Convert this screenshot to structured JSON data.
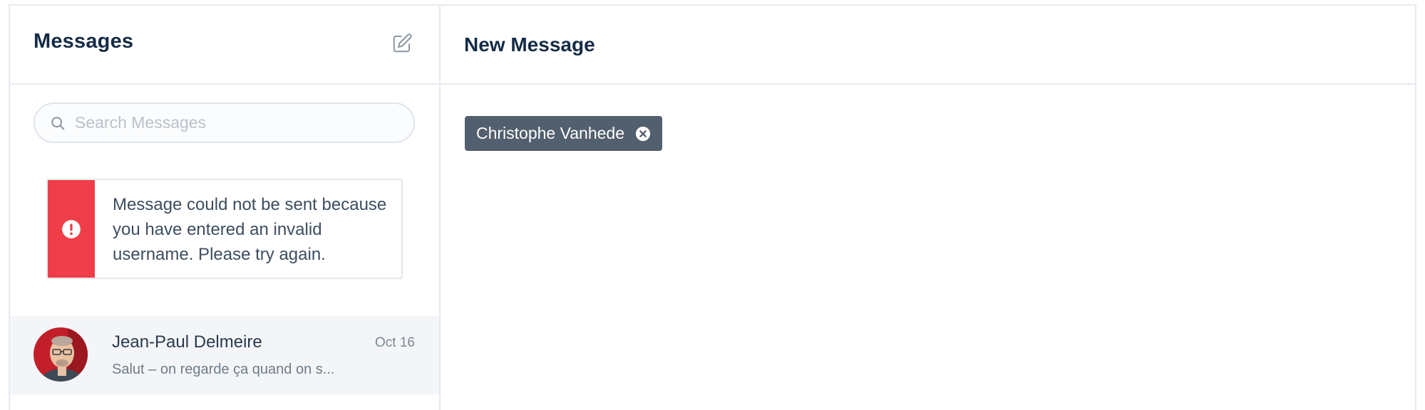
{
  "sidebar": {
    "title": "Messages",
    "compose_icon": "compose-edit-icon",
    "search": {
      "placeholder": "Search Messages",
      "value": "",
      "icon": "search-icon"
    },
    "alert": {
      "icon": "exclamation-circle-icon",
      "message": "Message could not be sent because you have entered an invalid username. Please try again.",
      "color": "#ef3e4a"
    },
    "conversations": [
      {
        "name": "Jean-Paul Delmeire",
        "date": "Oct 16",
        "preview": "Salut – on regarde ça quand on s..."
      }
    ]
  },
  "main": {
    "title": "New Message",
    "recipients": [
      {
        "label": "Christophe Vanhede",
        "remove_icon": "close-circle-icon"
      }
    ]
  },
  "colors": {
    "heading": "#152b46",
    "tag_bg": "#525f6e",
    "border": "#e6ebf1",
    "active_row": "#f3f5f8"
  }
}
